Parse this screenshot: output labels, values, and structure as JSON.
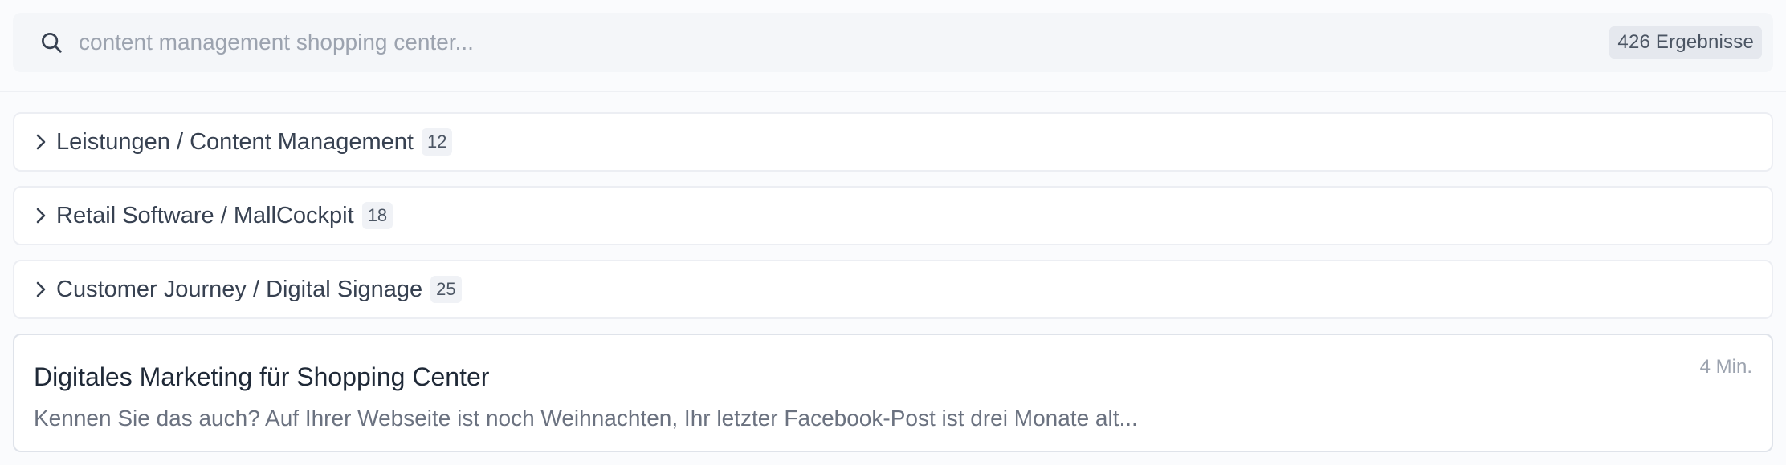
{
  "search": {
    "placeholder": "content management shopping center...",
    "value": "",
    "result_count": "426 Ergebnisse"
  },
  "icons": {
    "search": "search-icon",
    "chevron": "chevron-right-icon"
  },
  "groups": [
    {
      "label": "Leistungen / Content Management",
      "count": "12"
    },
    {
      "label": "Retail Software / MallCockpit",
      "count": "18"
    },
    {
      "label": "Customer Journey / Digital Signage",
      "count": "25"
    }
  ],
  "results": [
    {
      "title": "Digitales Marketing für Shopping Center",
      "excerpt": "Kennen Sie das auch? Auf Ihrer Webseite ist noch Weihnachten, Ihr letzter Facebook-Post ist drei Monate alt...",
      "read_time": "4 Min."
    }
  ],
  "colors": {
    "background": "#fafbfd",
    "search_bg": "#f4f6f9",
    "badge_bg": "#e5e8ee",
    "text": "#374151",
    "muted": "#6b7280"
  }
}
